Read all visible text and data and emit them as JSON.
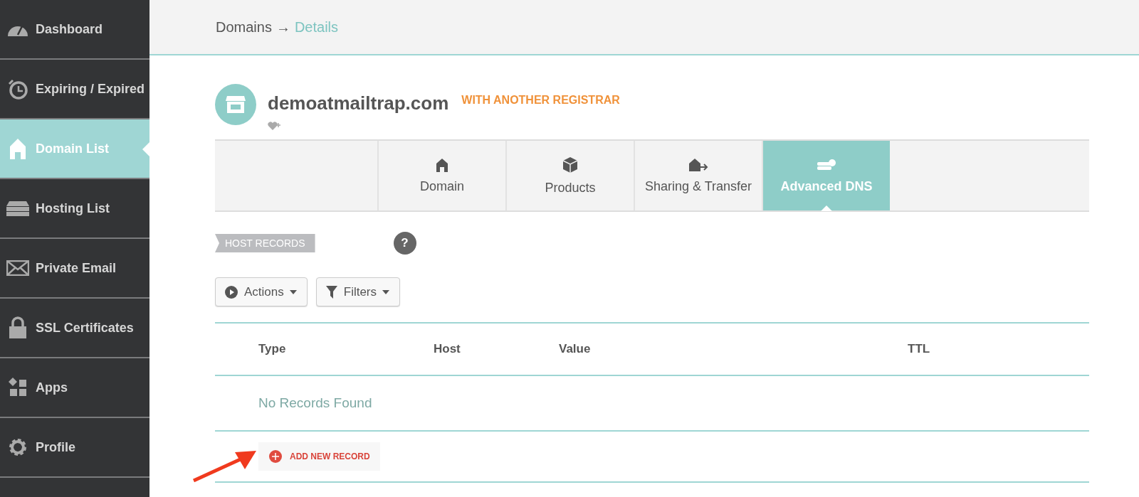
{
  "sidebar": {
    "items": [
      {
        "label": "Dashboard",
        "selected": false
      },
      {
        "label": "Expiring / Expired",
        "selected": false
      },
      {
        "label": "Domain List",
        "selected": true
      },
      {
        "label": "Hosting List",
        "selected": false
      },
      {
        "label": "Private Email",
        "selected": false
      },
      {
        "label": "SSL Certificates",
        "selected": false
      },
      {
        "label": "Apps",
        "selected": false
      },
      {
        "label": "Profile",
        "selected": false
      }
    ]
  },
  "breadcrumb": {
    "parent": "Domains",
    "separator": "→",
    "current": "Details"
  },
  "domain": {
    "name": "demoatmailtrap.com",
    "status": "WITH ANOTHER REGISTRAR"
  },
  "tabs": [
    {
      "label": "Domain",
      "selected": false
    },
    {
      "label": "Products",
      "selected": false
    },
    {
      "label": "Sharing & Transfer",
      "selected": false
    },
    {
      "label": "Advanced DNS",
      "selected": true
    }
  ],
  "section": {
    "label": "HOST RECORDS",
    "help": "?"
  },
  "toolbar": [
    "Actions",
    "Filters"
  ],
  "table": {
    "columns": [
      "Type",
      "Host",
      "Value",
      "TTL"
    ],
    "empty_message": "No Records Found",
    "add_button": "ADD NEW RECORD"
  }
}
